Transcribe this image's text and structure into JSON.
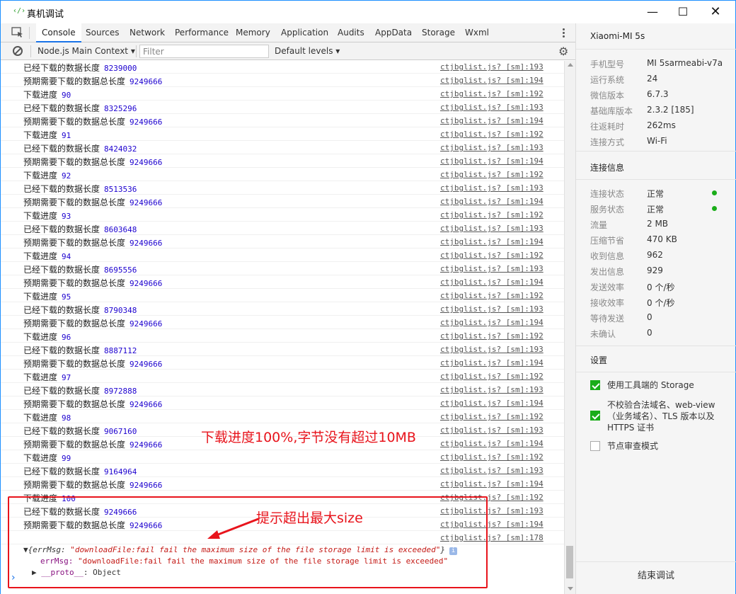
{
  "window": {
    "title": "真机调试",
    "app_icon": "‹/›",
    "minimize": "—",
    "maximize": "☐",
    "close": "✕"
  },
  "tabs": [
    "Console",
    "Sources",
    "Network",
    "Performance",
    "Memory",
    "Application",
    "Audits",
    "AppData",
    "Storage",
    "Wxml"
  ],
  "toolbar": {
    "context": "Node.js Main Context",
    "filter_placeholder": "Filter",
    "levels": "Default levels"
  },
  "logs": [
    {
      "label": "已经下载的数据长度",
      "value": "8239000",
      "src": "ctjbglist.js? [sm]:193"
    },
    {
      "label": "预期需要下载的数据总长度",
      "value": "9249666",
      "src": "ctjbglist.js? [sm]:194"
    },
    {
      "label": "下载进度",
      "value": "90",
      "src": "ctjbglist.js? [sm]:192"
    },
    {
      "label": "已经下载的数据长度",
      "value": "8325296",
      "src": "ctjbglist.js? [sm]:193"
    },
    {
      "label": "预期需要下载的数据总长度",
      "value": "9249666",
      "src": "ctjbglist.js? [sm]:194"
    },
    {
      "label": "下载进度",
      "value": "91",
      "src": "ctjbglist.js? [sm]:192"
    },
    {
      "label": "已经下载的数据长度",
      "value": "8424032",
      "src": "ctjbglist.js? [sm]:193"
    },
    {
      "label": "预期需要下载的数据总长度",
      "value": "9249666",
      "src": "ctjbglist.js? [sm]:194"
    },
    {
      "label": "下载进度",
      "value": "92",
      "src": "ctjbglist.js? [sm]:192"
    },
    {
      "label": "已经下载的数据长度",
      "value": "8513536",
      "src": "ctjbglist.js? [sm]:193"
    },
    {
      "label": "预期需要下载的数据总长度",
      "value": "9249666",
      "src": "ctjbglist.js? [sm]:194"
    },
    {
      "label": "下载进度",
      "value": "93",
      "src": "ctjbglist.js? [sm]:192"
    },
    {
      "label": "已经下载的数据长度",
      "value": "8603648",
      "src": "ctjbglist.js? [sm]:193"
    },
    {
      "label": "预期需要下载的数据总长度",
      "value": "9249666",
      "src": "ctjbglist.js? [sm]:194"
    },
    {
      "label": "下载进度",
      "value": "94",
      "src": "ctjbglist.js? [sm]:192"
    },
    {
      "label": "已经下载的数据长度",
      "value": "8695556",
      "src": "ctjbglist.js? [sm]:193"
    },
    {
      "label": "预期需要下载的数据总长度",
      "value": "9249666",
      "src": "ctjbglist.js? [sm]:194"
    },
    {
      "label": "下载进度",
      "value": "95",
      "src": "ctjbglist.js? [sm]:192"
    },
    {
      "label": "已经下载的数据长度",
      "value": "8790348",
      "src": "ctjbglist.js? [sm]:193"
    },
    {
      "label": "预期需要下载的数据总长度",
      "value": "9249666",
      "src": "ctjbglist.js? [sm]:194"
    },
    {
      "label": "下载进度",
      "value": "96",
      "src": "ctjbglist.js? [sm]:192"
    },
    {
      "label": "已经下载的数据长度",
      "value": "8887112",
      "src": "ctjbglist.js? [sm]:193"
    },
    {
      "label": "预期需要下载的数据总长度",
      "value": "9249666",
      "src": "ctjbglist.js? [sm]:194"
    },
    {
      "label": "下载进度",
      "value": "97",
      "src": "ctjbglist.js? [sm]:192"
    },
    {
      "label": "已经下载的数据长度",
      "value": "8972888",
      "src": "ctjbglist.js? [sm]:193"
    },
    {
      "label": "预期需要下载的数据总长度",
      "value": "9249666",
      "src": "ctjbglist.js? [sm]:194"
    },
    {
      "label": "下载进度",
      "value": "98",
      "src": "ctjbglist.js? [sm]:192"
    },
    {
      "label": "已经下载的数据长度",
      "value": "9067160",
      "src": "ctjbglist.js? [sm]:193"
    },
    {
      "label": "预期需要下载的数据总长度",
      "value": "9249666",
      "src": "ctjbglist.js? [sm]:194"
    },
    {
      "label": "下载进度",
      "value": "99",
      "src": "ctjbglist.js? [sm]:192"
    },
    {
      "label": "已经下载的数据长度",
      "value": "9164964",
      "src": "ctjbglist.js? [sm]:193"
    },
    {
      "label": "预期需要下载的数据总长度",
      "value": "9249666",
      "src": "ctjbglist.js? [sm]:194"
    },
    {
      "label": "下载进度",
      "value": "100",
      "src": "ctjbglist.js? [sm]:192"
    },
    {
      "label": "已经下载的数据长度",
      "value": "9249666",
      "src": "ctjbglist.js? [sm]:193"
    },
    {
      "label": "预期需要下载的数据总长度",
      "value": "9249666",
      "src": "ctjbglist.js? [sm]:194"
    }
  ],
  "error": {
    "src": "ctjbglist.js? [sm]:178",
    "summary_key": "{errMsg: ",
    "summary_value": "\"downloadFile:fail fail the maximum size of the file storage limit is exceeded\"",
    "summary_end": "}",
    "info_badge": "i",
    "prop_key": "errMsg: ",
    "prop_value": "\"downloadFile:fail fail the maximum size of the file storage limit is exceeded\"",
    "proto_key": "__proto__",
    "proto_value": ": Object"
  },
  "annotations": {
    "note1": "下载进度100%,字节没有超过10MB",
    "note2": "提示超出最大size",
    "color": "#e8141c"
  },
  "device": {
    "name": "Xiaomi-MI 5s",
    "info": [
      {
        "label": "手机型号",
        "value": "MI 5sarmeabi-v7a"
      },
      {
        "label": "运行系统",
        "value": "24"
      },
      {
        "label": "微信版本",
        "value": "6.7.3"
      },
      {
        "label": "基础库版本",
        "value": "2.3.2 [185]"
      },
      {
        "label": "往返耗时",
        "value": "262ms"
      },
      {
        "label": "连接方式",
        "value": "Wi-Fi"
      }
    ],
    "conn_title": "连接信息",
    "conn": [
      {
        "label": "连接状态",
        "value": "正常"
      },
      {
        "label": "服务状态",
        "value": "正常"
      },
      {
        "label": "流量",
        "value": "2 MB"
      },
      {
        "label": "压缩节省",
        "value": "470 KB"
      },
      {
        "label": "收到信息",
        "value": "962"
      },
      {
        "label": "发出信息",
        "value": "929"
      },
      {
        "label": "发送效率",
        "value": "0 个/秒"
      },
      {
        "label": "接收效率",
        "value": "0 个/秒"
      },
      {
        "label": "等待发送",
        "value": "0"
      },
      {
        "label": "未确认",
        "value": "0"
      }
    ],
    "settings_title": "设置",
    "settings": [
      {
        "label": "使用工具端的 Storage",
        "checked": true
      },
      {
        "label": "不校验合法域名、web-view（业务域名）、TLS 版本以及 HTTPS 证书",
        "checked": true
      },
      {
        "label": "节点审查模式",
        "checked": false
      }
    ],
    "end_button": "结束调试",
    "accent": "#1aad19"
  }
}
